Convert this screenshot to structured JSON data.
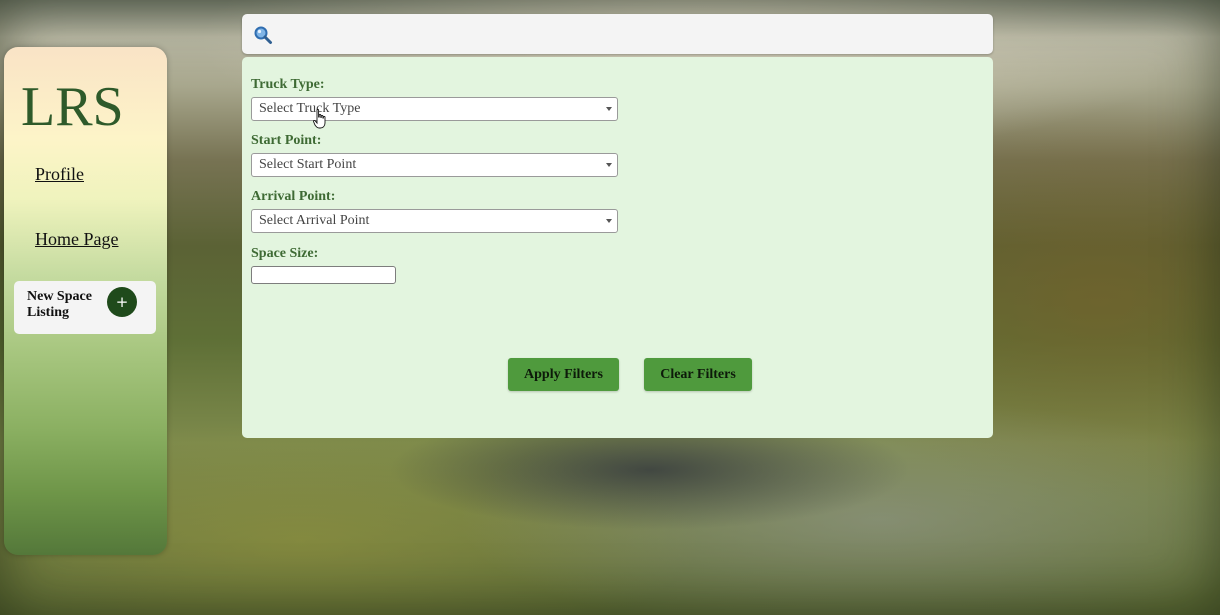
{
  "sidebar": {
    "logo": "LRS",
    "nav": {
      "profile": "Profile",
      "home": "Home Page"
    },
    "new_listing": {
      "label": "New Space Listing",
      "button": "+"
    }
  },
  "search": {
    "icon": "search-icon",
    "value": ""
  },
  "filters": {
    "truck_type": {
      "label": "Truck Type:",
      "selected": "Select Truck Type"
    },
    "start_point": {
      "label": "Start Point:",
      "selected": "Select Start Point"
    },
    "arrival_point": {
      "label": "Arrival Point:",
      "selected": "Select Arrival Point"
    },
    "space_size": {
      "label": "Space Size:",
      "value": ""
    },
    "apply_label": "Apply Filters",
    "clear_label": "Clear Filters"
  },
  "colors": {
    "panel_bg": "#e3f5df",
    "button_green": "#4f9a3d",
    "label_green": "#3e6a34",
    "logo_green": "#2e5a2a",
    "plus_button": "#1f4a1b"
  }
}
